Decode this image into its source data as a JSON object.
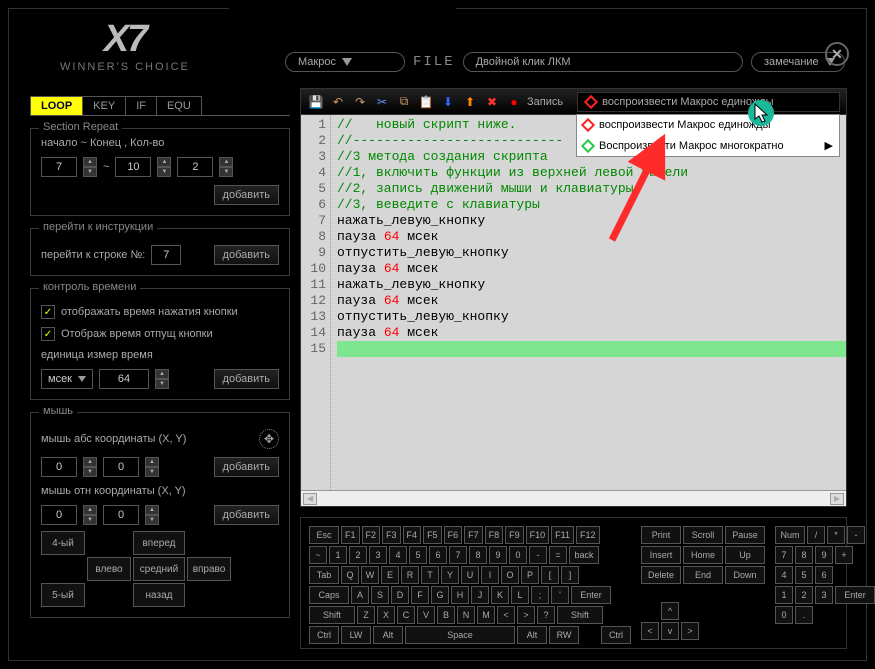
{
  "brand": {
    "main": "X7",
    "sub": "WINNER'S CHOICE"
  },
  "topbar": {
    "macro_label": "Макрос",
    "file_label": "FILE",
    "filename": "Двойной клик ЛКМ",
    "note_label": "замечание"
  },
  "tabs": [
    "LOOP",
    "KEY",
    "IF",
    "EQU"
  ],
  "section_repeat": {
    "title": "Section Repeat",
    "label": "начало ~ Конец , Кол-во",
    "start": "7",
    "end": "10",
    "count": "2",
    "add": "добавить"
  },
  "goto": {
    "title": "перейти к инструкции",
    "label": "перейти к строке №:",
    "value": "7",
    "add": "добавить"
  },
  "time_ctrl": {
    "title": "контроль времени",
    "opt1": "отображать время нажатия кнопки",
    "opt2": "Отображ время отпущ кнопки",
    "unit_label": "единица измер время",
    "unit": "мсек",
    "value": "64",
    "add": "добавить"
  },
  "mouse": {
    "title": "мышь",
    "abs_label": "мышь абс координаты (X, Y)",
    "rel_label": "мышь отн координаты (X, Y)",
    "x": "0",
    "y": "0",
    "add": "добавить",
    "btns": {
      "b4": "4-ый",
      "b5": "5-ый",
      "fwd": "вперед",
      "back": "назад",
      "left": "влево",
      "mid": "средний",
      "right": "вправо"
    }
  },
  "toolbar": {
    "record": "Запись",
    "play_combo": "воспроизвести Макрос единожды"
  },
  "context": {
    "once": "воспроизвести Макрос единожды",
    "repeat": "Воспроизвести Макрос многократно"
  },
  "code_lines": [
    {
      "n": 1,
      "type": "cm",
      "text": "//   новый скрипт ниже."
    },
    {
      "n": 2,
      "type": "cm",
      "text": "//---------------------------"
    },
    {
      "n": 3,
      "type": "cm",
      "text": "//3 метода создания скрипта"
    },
    {
      "n": 4,
      "type": "cm",
      "text": "//1, включить функции из верхней левой панели"
    },
    {
      "n": 5,
      "type": "cm",
      "text": "//2, запись движений мыши и клавиатуры"
    },
    {
      "n": 6,
      "type": "cm",
      "text": "//3, веведите с клавиатуры"
    },
    {
      "n": 7,
      "type": "txt",
      "text": "нажать_левую_кнопку"
    },
    {
      "n": 8,
      "type": "mix",
      "pre": "пауза ",
      "num": "64",
      "post": " мсек"
    },
    {
      "n": 9,
      "type": "txt",
      "text": "отпустить_левую_кнопку"
    },
    {
      "n": 10,
      "type": "mix",
      "pre": "пауза ",
      "num": "64",
      "post": " мсек"
    },
    {
      "n": 11,
      "type": "txt",
      "text": "нажать_левую_кнопку"
    },
    {
      "n": 12,
      "type": "mix",
      "pre": "пауза ",
      "num": "64",
      "post": " мсек"
    },
    {
      "n": 13,
      "type": "txt",
      "text": "отпустить_левую_кнопку"
    },
    {
      "n": 14,
      "type": "mix",
      "pre": "пауза ",
      "num": "64",
      "post": " мсек"
    },
    {
      "n": 15,
      "type": "cur",
      "text": ""
    }
  ],
  "kb": {
    "r0": [
      "Esc",
      "F1",
      "F2",
      "F3",
      "F4",
      "F5",
      "F6",
      "F7",
      "F8",
      "F9",
      "F10",
      "F11",
      "F12"
    ],
    "r1": [
      "~",
      "1",
      "2",
      "3",
      "4",
      "5",
      "6",
      "7",
      "8",
      "9",
      "0",
      "-",
      "=",
      "back"
    ],
    "r2": [
      "Tab",
      "Q",
      "W",
      "E",
      "R",
      "T",
      "Y",
      "U",
      "I",
      "O",
      "P",
      "[",
      "]"
    ],
    "r3": [
      "Caps",
      "A",
      "S",
      "D",
      "F",
      "G",
      "H",
      "J",
      "K",
      "L",
      ";",
      "'",
      "Enter"
    ],
    "r4": [
      "Shift",
      "Z",
      "X",
      "C",
      "V",
      "B",
      "N",
      "M",
      "<",
      ">",
      "?",
      "Shift"
    ],
    "r5": [
      "Ctrl",
      "LW",
      "Alt",
      "Space",
      "Alt",
      "RW",
      "",
      "Ctrl"
    ],
    "nav0": [
      "Print",
      "Scroll",
      "Pause"
    ],
    "nav1": [
      "Insert",
      "Home",
      "Up"
    ],
    "nav2": [
      "Delete",
      "End",
      "Down"
    ],
    "nav3": [
      "",
      "^",
      ""
    ],
    "nav4": [
      "<",
      "v",
      ">"
    ],
    "np0": [
      "Num",
      "/",
      "*",
      "-"
    ],
    "np1": [
      "7",
      "8",
      "9",
      "+"
    ],
    "np2": [
      "4",
      "5",
      "6"
    ],
    "np3": [
      "1",
      "2",
      "3",
      "Enter"
    ],
    "np4": [
      "0",
      ".",
      ""
    ]
  }
}
